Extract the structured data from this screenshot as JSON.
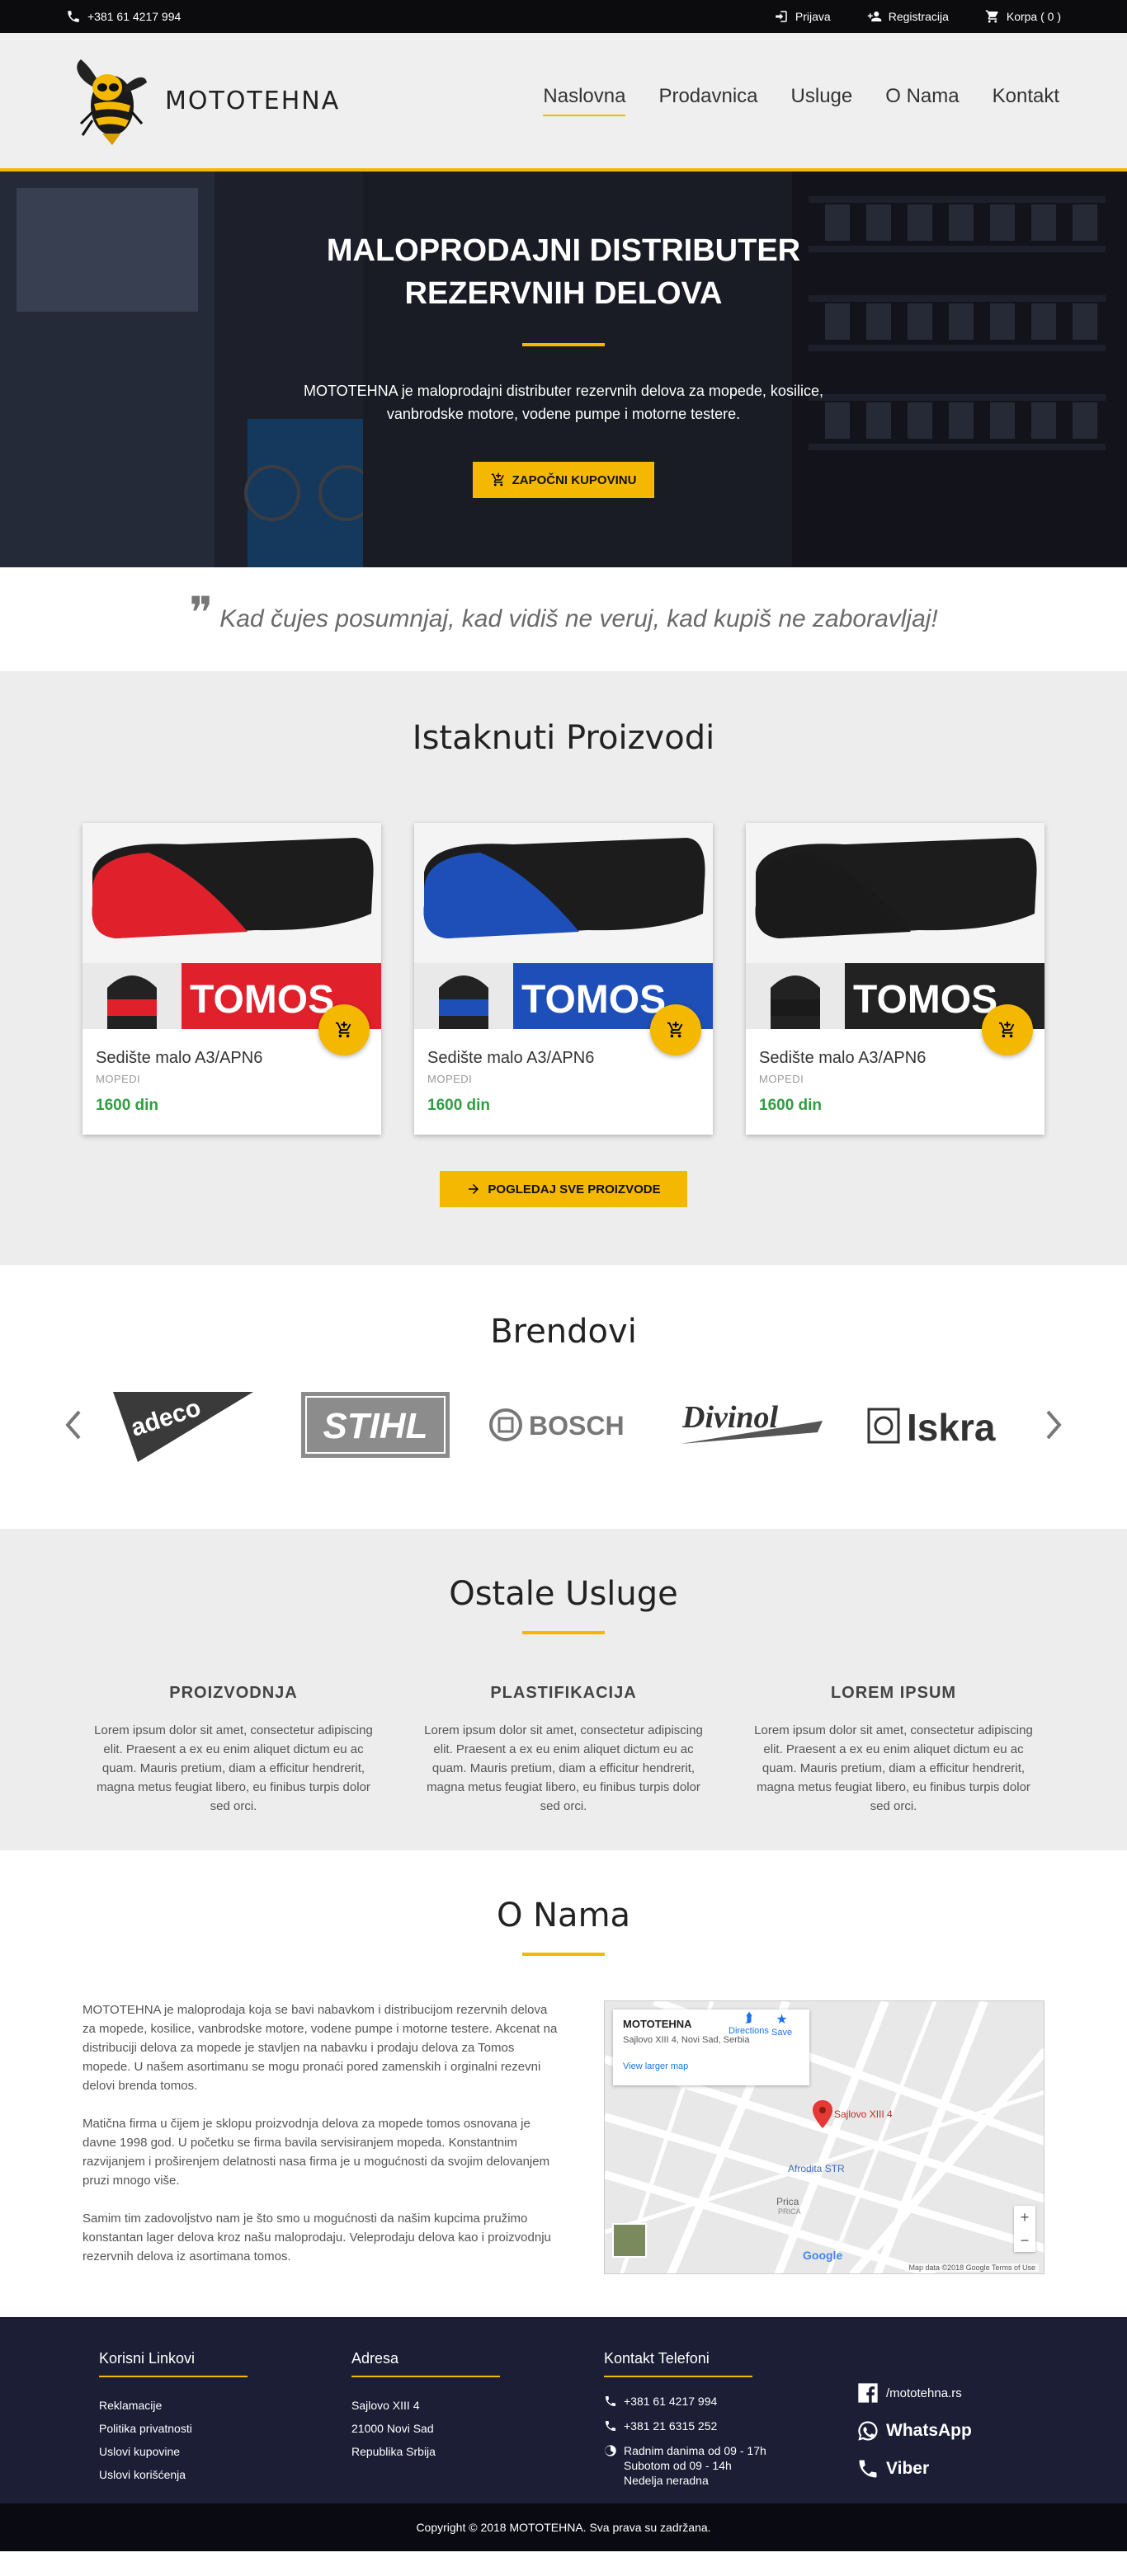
{
  "topbar": {
    "phone": "+381 61 4217 994",
    "login": "Prijava",
    "register": "Registracija",
    "cart": "Korpa ( 0 )"
  },
  "header": {
    "brand": "MOTOTEHNA",
    "nav": [
      "Naslovna",
      "Prodavnica",
      "Usluge",
      "O Nama",
      "Kontakt"
    ],
    "active_nav": "Naslovna"
  },
  "hero": {
    "title": "MALOPRODAJNI DISTRIBUTER REZERVNIH DELOVA",
    "text": "MOTOTEHNA je maloprodajni distributer rezervnih delova za mopede, kosilice, vanbrodske motore, vodene pumpe i motorne testere.",
    "cta": "ZAPOČNI KUPOVINU"
  },
  "quote": {
    "text": "Kad čujes posumnjaj, kad vidiš ne veruj, kad kupiš ne zaboravljaj!"
  },
  "featured": {
    "title": "Istaknuti Proizvodi",
    "products": [
      {
        "name": "Sedište malo A3/APN6",
        "category": "MOPEDI",
        "price": "1600 din",
        "seat_color": "#e0212b",
        "logo_text": "TOMOS"
      },
      {
        "name": "Sedište malo A3/APN6",
        "category": "MOPEDI",
        "price": "1600 din",
        "seat_color": "#1e4fb8",
        "logo_text": "TOMOS"
      },
      {
        "name": "Sedište malo A3/APN6",
        "category": "MOPEDI",
        "price": "1600 din",
        "seat_color": "#1a1a1a",
        "logo_text": "TOMOS"
      }
    ],
    "all_button": "POGLEDAJ SVE PROIZVODE"
  },
  "brands": {
    "title": "Brendovi",
    "logos": [
      "adeco",
      "STIHL",
      "BOSCH",
      "Divinol",
      "Iskra"
    ]
  },
  "services": {
    "title": "Ostale Usluge",
    "items": [
      {
        "title": "PROIZVODNJA",
        "text": "Lorem ipsum dolor sit amet, consectetur adipiscing elit. Praesent a ex eu enim aliquet dictum eu ac quam. Mauris pretium, diam a efficitur hendrerit, magna metus feugiat libero, eu finibus turpis dolor sed orci."
      },
      {
        "title": "PLASTIFIKACIJA",
        "text": "Lorem ipsum dolor sit amet, consectetur adipiscing elit. Praesent a ex eu enim aliquet dictum eu ac quam. Mauris pretium, diam a efficitur hendrerit, magna metus feugiat libero, eu finibus turpis dolor sed orci."
      },
      {
        "title": "LOREM IPSUM",
        "text": "Lorem ipsum dolor sit amet, consectetur adipiscing elit. Praesent a ex eu enim aliquet dictum eu ac quam. Mauris pretium, diam a efficitur hendrerit, magna metus feugiat libero, eu finibus turpis dolor sed orci."
      }
    ]
  },
  "about": {
    "title": "O Nama",
    "paragraphs": [
      "MOTOTEHNA je maloprodaja koja se bavi nabavkom i distribucijom rezervnih delova za mopede, kosilice, vanbrodske motore, vodene pumpe i motorne testere. Akcenat na distribuciji delova za mopede je stavljen na nabavku i prodaju delova za Tomos mopede. U našem asortimanu se mogu pronaći pored zamenskih i orginalni rezevni delovi brenda tomos.",
      "Matična firma u čijem je sklopu proizvodnja delova za mopede tomos osnovana je davne 1998 god. U početku se firma bavila servisiranjem mopeda. Konstantnim razvijanjem i proširenjem delatnosti nasa firma je u mogućnosti da svojim delovanjem pruzi mnogo više.",
      "Samim tim zadovoljstvo nam je što smo u mogućnosti da našim kupcima pružimo konstantan lager delova kroz našu maloprodaju. Veleprodaju delova kao i proizvodnju rezervnih delova iz asortimana tomos."
    ],
    "map": {
      "place": "MOTOTEHNA",
      "address": "Sajlovo XIII 4, Novi Sad, Serbia",
      "larger": "View larger map",
      "directions": "Directions",
      "save": "Save",
      "pin_label": "Sajlovo XIII 4",
      "poi1": "Afrodita STR",
      "poi2": "Prica",
      "poi2_sub": "PRICA",
      "google": "Google",
      "credit": "Map data ©2018 Google  Terms of Use",
      "zoom_in": "+",
      "zoom_out": "−"
    }
  },
  "footer": {
    "links_title": "Korisni Linkovi",
    "links": [
      "Reklamacije",
      "Politika privatnosti",
      "Uslovi kupovine",
      "Uslovi korišćenja"
    ],
    "address_title": "Adresa",
    "address": [
      "Sajlovo XIII 4",
      "21000 Novi Sad",
      "Republika Srbija"
    ],
    "contact_title": "Kontakt Telefoni",
    "phones": [
      "+381 61 4217 994",
      "+381 21 6315 252"
    ],
    "hours": [
      "Radnim danima od 09 - 17h",
      "Subotom od 09 - 14h",
      "Nedelja neradna"
    ],
    "facebook": "/mototehna.rs",
    "whatsapp": "WhatsApp",
    "viber": "Viber",
    "copyright": "Copyright © 2018 MOTOTEHNA. Sva prava su zadržana."
  },
  "colors": {
    "accent": "#f5b800",
    "price": "#2e9e3e",
    "footer": "#1b1e35"
  }
}
